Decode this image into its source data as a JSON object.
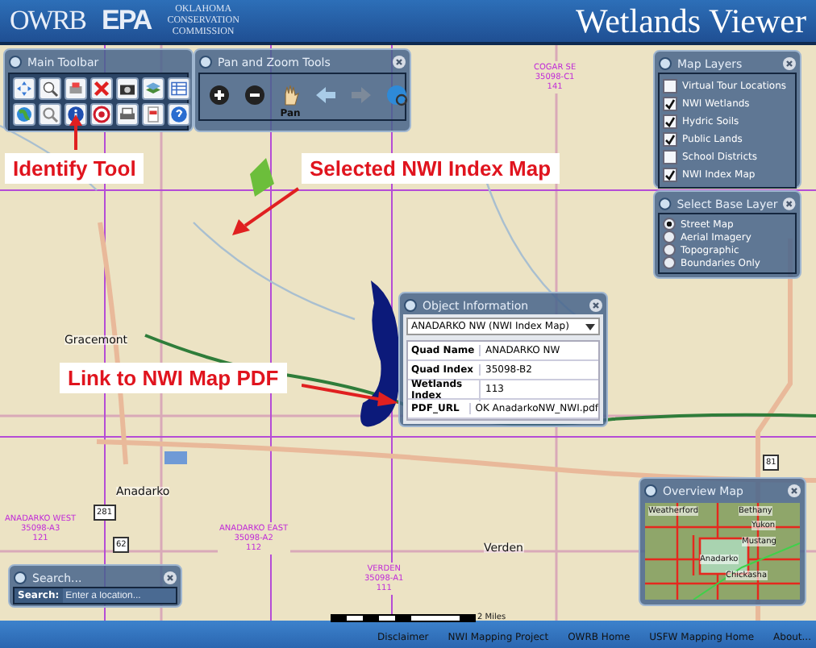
{
  "header": {
    "logos": [
      "OWRB",
      "EPA"
    ],
    "commission": [
      "OKLAHOMA",
      "CONSERVATION",
      "COMMISSION"
    ],
    "title": "Wetlands Viewer"
  },
  "main_toolbar": {
    "title": "Main Toolbar"
  },
  "pan_zoom": {
    "title": "Pan and Zoom Tools",
    "active_label": "Pan"
  },
  "map_layers": {
    "title": "Map Layers",
    "items": [
      {
        "label": "Virtual Tour Locations",
        "checked": false
      },
      {
        "label": "NWI Wetlands",
        "checked": true
      },
      {
        "label": "Hydric Soils",
        "checked": true
      },
      {
        "label": "Public Lands",
        "checked": true
      },
      {
        "label": "School Districts",
        "checked": false
      },
      {
        "label": "NWI Index Map",
        "checked": true
      }
    ]
  },
  "base_layer": {
    "title": "Select Base Layer",
    "options": [
      {
        "label": "Street Map",
        "selected": true
      },
      {
        "label": "Aerial Imagery",
        "selected": false
      },
      {
        "label": "Topographic",
        "selected": false
      },
      {
        "label": "Boundaries Only",
        "selected": false
      }
    ]
  },
  "object_info": {
    "title": "Object Information",
    "dropdown": "ANADARKO NW (NWI Index Map)",
    "rows": [
      {
        "field": "Quad Name",
        "value": "ANADARKO NW"
      },
      {
        "field": "Quad Index",
        "value": "35098-B2"
      },
      {
        "field": "Wetlands Index",
        "value": "113"
      },
      {
        "field": "PDF_URL",
        "value": "OK AnadarkoNW_NWI.pdf"
      }
    ]
  },
  "map": {
    "labels": [
      {
        "kind": "quad",
        "lines": [
          "COGAR SE",
          "35098-C1",
          "141"
        ]
      },
      {
        "kind": "quad",
        "lines": [
          "ANADARKO WEST",
          "35098-A3",
          "121"
        ]
      },
      {
        "kind": "quad",
        "lines": [
          "ANADARKO EAST",
          "35098-A2",
          "112"
        ]
      },
      {
        "kind": "quad",
        "lines": [
          "VERDEN",
          "35098-A1",
          "111"
        ]
      },
      {
        "kind": "place",
        "lines": [
          "Gracemont"
        ]
      },
      {
        "kind": "place",
        "lines": [
          "Anadarko"
        ]
      },
      {
        "kind": "place",
        "lines": [
          "Verden"
        ]
      },
      {
        "kind": "shield",
        "lines": [
          "281"
        ]
      },
      {
        "kind": "shield",
        "lines": [
          "62"
        ]
      },
      {
        "kind": "shield",
        "lines": [
          "81"
        ]
      }
    ]
  },
  "callouts": [
    {
      "text": "Identify Tool"
    },
    {
      "text": "Selected NWI Index Map"
    },
    {
      "text": "Link to NWI Map PDF"
    }
  ],
  "search": {
    "title": "Search...",
    "label": "Search:",
    "placeholder": "Enter a location..."
  },
  "overview": {
    "title": "Overview Map",
    "labels": [
      "Weatherford",
      "Bethany",
      "Yukon",
      "Mustang",
      "Anadarko",
      "Chickasha"
    ]
  },
  "footer": {
    "scale": "2 Miles",
    "links": [
      "Disclaimer",
      "NWI Mapping Project",
      "OWRB Home",
      "USFW Mapping Home",
      "About..."
    ]
  }
}
